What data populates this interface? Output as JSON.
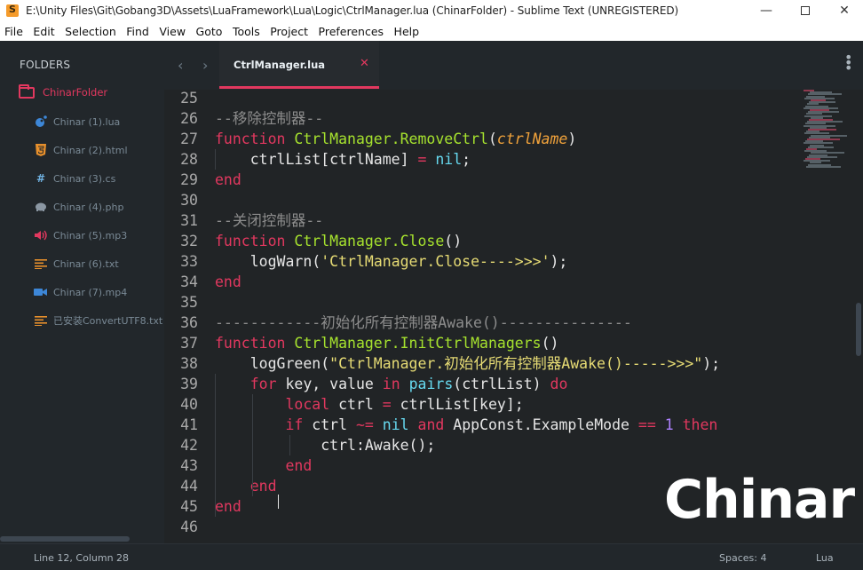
{
  "window": {
    "title": "E:\\Unity Files\\Git\\Gobang3D\\Assets\\LuaFramework\\Lua\\Logic\\CtrlManager.lua (ChinarFolder) - Sublime Text (UNREGISTERED)",
    "minimize": "—",
    "close": "✕"
  },
  "menu": [
    "File",
    "Edit",
    "Selection",
    "Find",
    "View",
    "Goto",
    "Tools",
    "Project",
    "Preferences",
    "Help"
  ],
  "sidebar": {
    "header": "FOLDERS",
    "folder": "ChinarFolder",
    "files": [
      {
        "label": "Chinar (1).lua",
        "icon": "lua-icon"
      },
      {
        "label": "Chinar (2).html",
        "icon": "html5-icon"
      },
      {
        "label": "Chinar (3).cs",
        "icon": "hash-icon"
      },
      {
        "label": "Chinar (4).php",
        "icon": "elephant-icon"
      },
      {
        "label": "Chinar (5).mp3",
        "icon": "speaker-icon"
      },
      {
        "label": "Chinar (6).txt",
        "icon": "text-lines-icon"
      },
      {
        "label": "Chinar (7).mp4",
        "icon": "video-camera-icon"
      },
      {
        "label": "已安装ConvertUTF8.txt",
        "icon": "text-lines-icon"
      }
    ]
  },
  "tabs": {
    "nav_left": "‹",
    "nav_right": "›",
    "active_label": "CtrlManager.lua",
    "close": "✕",
    "menu": "⋮"
  },
  "editor": {
    "line_numbers": [
      "25",
      "26",
      "27",
      "28",
      "29",
      "30",
      "31",
      "32",
      "33",
      "34",
      "35",
      "36",
      "37",
      "38",
      "39",
      "40",
      "41",
      "42",
      "43",
      "44",
      "45",
      "46"
    ],
    "lines": [
      [],
      [
        {
          "t": "--移除控制器--",
          "c": "cm"
        }
      ],
      [
        {
          "t": "function ",
          "c": "kw"
        },
        {
          "t": "CtrlManager.RemoveCtrl",
          "c": "fn"
        },
        {
          "t": "(",
          "c": "def"
        },
        {
          "t": "ctrlName",
          "c": "pa"
        },
        {
          "t": ")",
          "c": "def"
        }
      ],
      [
        {
          "t": "    ctrlList[ctrlName] ",
          "c": "def"
        },
        {
          "t": "=",
          "c": "op"
        },
        {
          "t": " ",
          "c": "def"
        },
        {
          "t": "nil",
          "c": "nil"
        },
        {
          "t": ";",
          "c": "def"
        }
      ],
      [
        {
          "t": "end",
          "c": "kw"
        }
      ],
      [],
      [
        {
          "t": "--关闭控制器--",
          "c": "cm"
        }
      ],
      [
        {
          "t": "function ",
          "c": "kw"
        },
        {
          "t": "CtrlManager.Close",
          "c": "fn"
        },
        {
          "t": "()",
          "c": "def"
        }
      ],
      [
        {
          "t": "    logWarn(",
          "c": "def"
        },
        {
          "t": "'CtrlManager.Close---->>>'",
          "c": "st"
        },
        {
          "t": ");",
          "c": "def"
        }
      ],
      [
        {
          "t": "end",
          "c": "kw"
        }
      ],
      [],
      [
        {
          "t": "------------初始化所有控制器Awake()---------------",
          "c": "cm"
        }
      ],
      [
        {
          "t": "function ",
          "c": "kw"
        },
        {
          "t": "CtrlManager.InitCtrlManagers",
          "c": "fn"
        },
        {
          "t": "()",
          "c": "def"
        }
      ],
      [
        {
          "t": "    logGreen(",
          "c": "def"
        },
        {
          "t": "\"CtrlManager.初始化所有控制器Awake()----->>>\"",
          "c": "st"
        },
        {
          "t": ");",
          "c": "def"
        }
      ],
      [
        {
          "t": "    ",
          "c": "def"
        },
        {
          "t": "for",
          "c": "kw"
        },
        {
          "t": " key, value ",
          "c": "def"
        },
        {
          "t": "in",
          "c": "kw"
        },
        {
          "t": " ",
          "c": "def"
        },
        {
          "t": "pairs",
          "c": "bi"
        },
        {
          "t": "(ctrlList) ",
          "c": "def"
        },
        {
          "t": "do",
          "c": "kw"
        }
      ],
      [
        {
          "t": "        ",
          "c": "def"
        },
        {
          "t": "local",
          "c": "kw"
        },
        {
          "t": " ctrl ",
          "c": "def"
        },
        {
          "t": "=",
          "c": "op"
        },
        {
          "t": " ctrlList[key];",
          "c": "def"
        }
      ],
      [
        {
          "t": "        ",
          "c": "def"
        },
        {
          "t": "if",
          "c": "kw"
        },
        {
          "t": " ctrl ",
          "c": "def"
        },
        {
          "t": "~=",
          "c": "op"
        },
        {
          "t": " ",
          "c": "def"
        },
        {
          "t": "nil",
          "c": "nil"
        },
        {
          "t": " ",
          "c": "def"
        },
        {
          "t": "and",
          "c": "kw"
        },
        {
          "t": " AppConst.ExampleMode ",
          "c": "def"
        },
        {
          "t": "==",
          "c": "op"
        },
        {
          "t": " ",
          "c": "def"
        },
        {
          "t": "1",
          "c": "nm"
        },
        {
          "t": " ",
          "c": "def"
        },
        {
          "t": "then",
          "c": "kw"
        }
      ],
      [
        {
          "t": "            ctrl:Awake();",
          "c": "def"
        }
      ],
      [
        {
          "t": "        ",
          "c": "def"
        },
        {
          "t": "end",
          "c": "kw"
        }
      ],
      [
        {
          "t": "    ",
          "c": "def"
        },
        {
          "t": "end",
          "c": "kw"
        }
      ],
      [
        {
          "t": "end",
          "c": "kw"
        }
      ],
      []
    ]
  },
  "watermark": "Chinar",
  "status": {
    "position": "Line 12, Column 28",
    "indent": "Spaces: 4",
    "syntax": "Lua"
  }
}
